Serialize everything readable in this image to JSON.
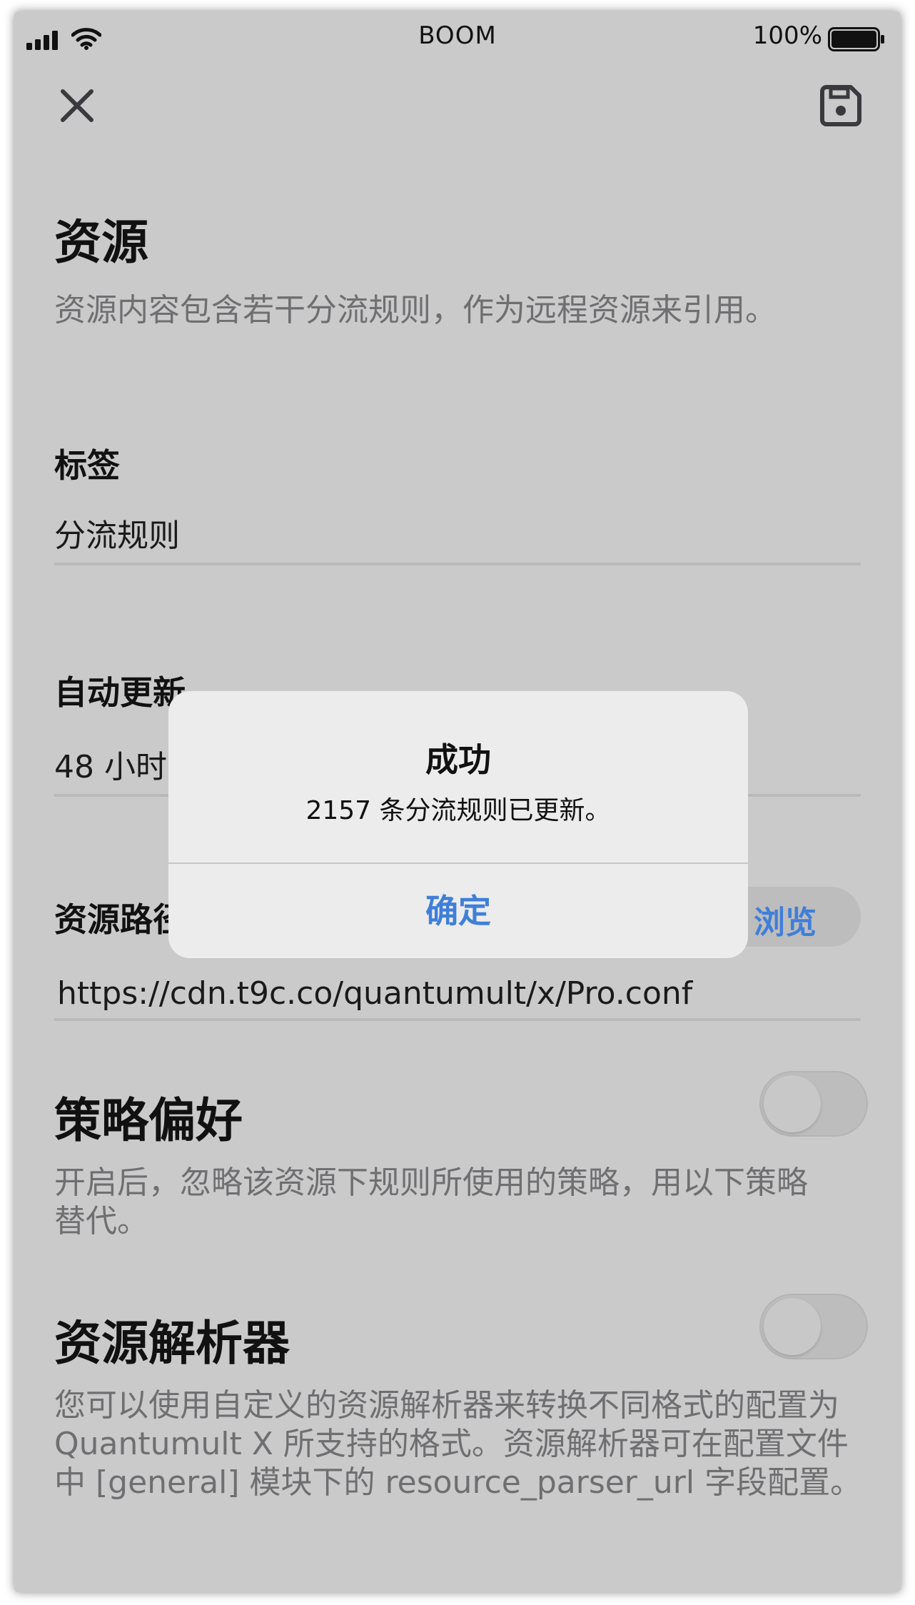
{
  "status_bar": {
    "carrier": "BOOM",
    "battery_percent": "100%",
    "battery_level": 1.0
  },
  "toolbar": {
    "close_icon": "close-icon",
    "save_icon": "save-icon"
  },
  "page": {
    "title": "资源",
    "description": "资源内容包含若干分流规则，作为远程资源来引用。"
  },
  "tag_field": {
    "label": "标签",
    "value": "分流规则"
  },
  "auto_update_field": {
    "label": "自动更新",
    "value": "48 小时"
  },
  "resource_path_field": {
    "label": "资源路径",
    "value": "https://cdn.t9c.co/quantumult/x/Pro.conf",
    "browse_label": "浏览"
  },
  "policy_preference": {
    "title": "策略偏好",
    "description": "开启后，忽略该资源下规则所使用的策略，用以下策略替代。",
    "enabled": false
  },
  "resource_parser": {
    "title": "资源解析器",
    "description": "您可以使用自定义的资源解析器来转换不同格式的配置为 Quantumult X 所支持的格式。资源解析器可在配置文件中 [general] 模块下的 resource_parser_url 字段配置。",
    "enabled": false
  },
  "alert": {
    "title": "成功",
    "message": "2157 条分流规则已更新。",
    "confirm_label": "确定"
  },
  "colors": {
    "accent": "#3f7fd8",
    "background": "#cacaca",
    "alert_background": "#ececed",
    "muted_text": "#6f6f72"
  }
}
